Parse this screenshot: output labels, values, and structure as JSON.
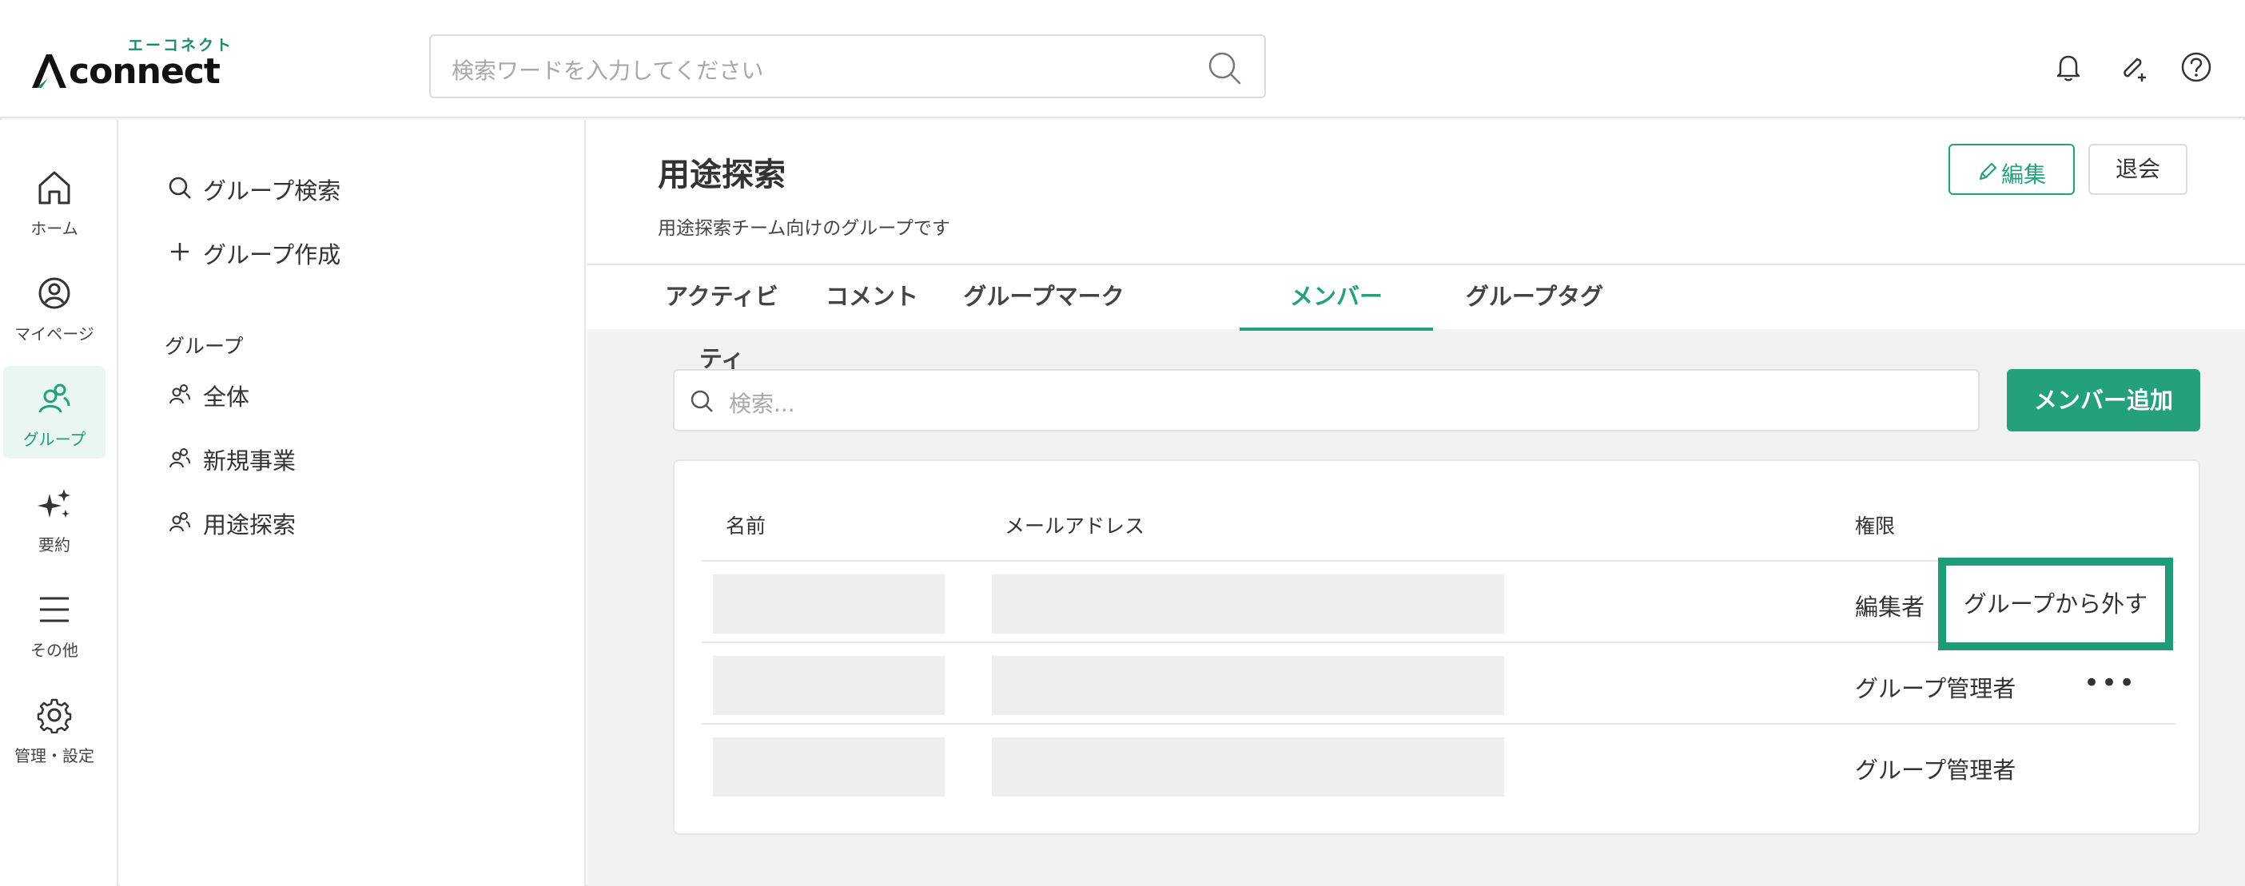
{
  "header": {
    "logo_kana": "エーコネクト",
    "logo_text": "connect",
    "search_placeholder": "検索ワードを入力してください"
  },
  "rail": {
    "items": [
      {
        "label": "ホーム",
        "icon": "home-icon"
      },
      {
        "label": "マイページ",
        "icon": "user-circle-icon"
      },
      {
        "label": "グループ",
        "icon": "group-icon",
        "active": true
      },
      {
        "label": "要約",
        "icon": "sparkle-icon"
      },
      {
        "label": "その他",
        "icon": "menu-icon"
      },
      {
        "label": "管理・設定",
        "icon": "gear-icon"
      }
    ]
  },
  "sidebar": {
    "search_label": "グループ検索",
    "create_label": "グループ作成",
    "section_label": "グループ",
    "groups": [
      "全体",
      "新規事業",
      "用途探索"
    ]
  },
  "group": {
    "title": "用途探索",
    "description": "用途探索チーム向けのグループです",
    "edit_label": "編集",
    "leave_label": "退会"
  },
  "tabs": [
    "アクティビティ",
    "コメント",
    "グループマーク",
    "メンバー",
    "グループタグ"
  ],
  "active_tab": "メンバー",
  "members": {
    "search_placeholder": "検索...",
    "add_label": "メンバー追加",
    "columns": [
      "名前",
      "メールアドレス",
      "権限"
    ],
    "rows": [
      {
        "role": "編集者"
      },
      {
        "role": "グループ管理者"
      },
      {
        "role": "グループ管理者"
      }
    ],
    "more_label": "•••"
  },
  "popup": {
    "label": "グループから外す"
  },
  "colors": {
    "accent": "#25a07d",
    "background": "#f2f2f2"
  }
}
